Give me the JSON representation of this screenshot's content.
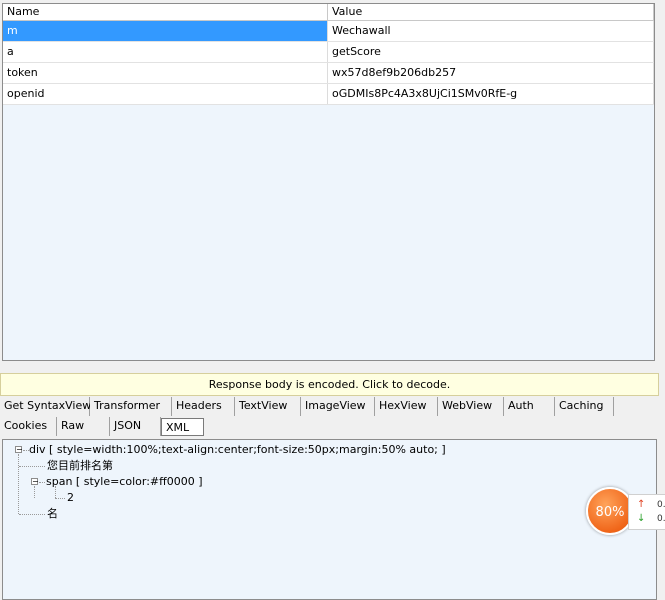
{
  "grid": {
    "headers": {
      "name": "Name",
      "value": "Value"
    },
    "rows": [
      {
        "name": "m",
        "value": "Wechawall"
      },
      {
        "name": "a",
        "value": "getScore"
      },
      {
        "name": "token",
        "value": "wx57d8ef9b206db257"
      },
      {
        "name": "openid",
        "value": "oGDMIs8Pc4A3x8UjCi1SMv0RfE-g"
      }
    ]
  },
  "banner": {
    "text": "Response body is encoded. Click to decode."
  },
  "tabs": {
    "row1": [
      "Get SyntaxView",
      "Transformer",
      "Headers",
      "TextView",
      "ImageView",
      "HexView",
      "WebView",
      "Auth",
      "Caching"
    ],
    "row2": [
      "Cookies",
      "Raw",
      "JSON",
      "XML"
    ]
  },
  "tree": {
    "div": "div [ style=width:100%;text-align:center;font-size:50px;margin:50% auto; ]",
    "text1": "您目前排名第",
    "span": "span [ style=color:#ff0000 ]",
    "num": "2",
    "text2": "名"
  },
  "badge": {
    "percent": "80%",
    "up": "0.",
    "down": "0."
  },
  "colors": {
    "selection": "#3399ff",
    "badge": "#f0661a"
  }
}
